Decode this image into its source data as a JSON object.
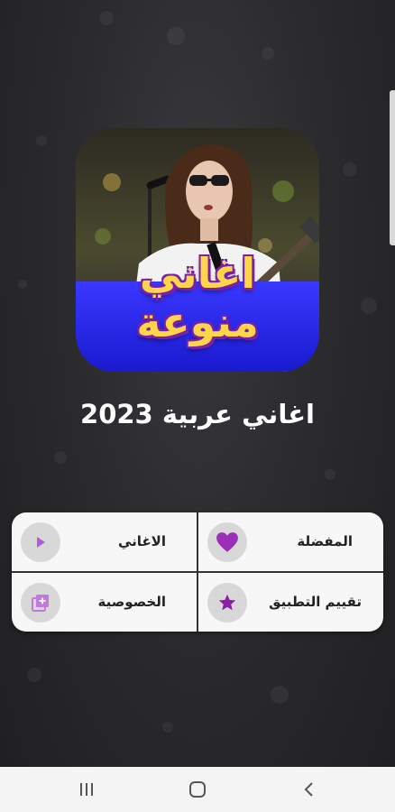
{
  "cover": {
    "title": "اغاني منوعة"
  },
  "app_title": "اغاني عربية 2023",
  "menu": {
    "items": [
      {
        "label": "المفضلة",
        "icon": "heart-icon"
      },
      {
        "label": "الاغاني",
        "icon": "play-icon"
      },
      {
        "label": "تقييم التطبيق",
        "icon": "star-icon"
      },
      {
        "label": "الخصوصية",
        "icon": "add-to-queue-icon"
      }
    ]
  },
  "navbar": {
    "buttons": [
      "recent-apps-icon",
      "home-icon",
      "back-icon"
    ]
  },
  "colors": {
    "accent": "#9b2fb7",
    "cover_title": "#ffd54a",
    "cover_banner": "#2a2fe0"
  }
}
